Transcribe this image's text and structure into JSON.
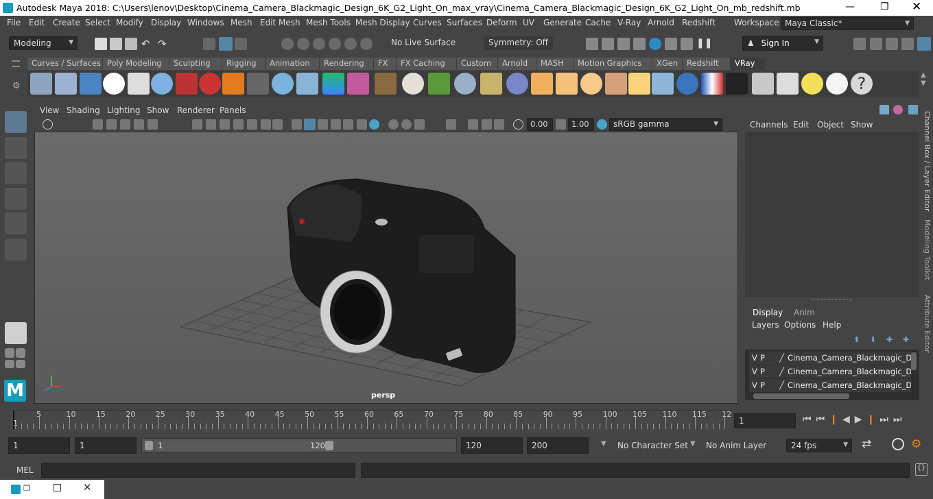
{
  "window": {
    "title": "Autodesk Maya 2018: C:\\Users\\lenov\\Desktop\\Cinema_Camera_Blackmagic_Design_6K_G2_Light_On_max_vray\\Cinema_Camera_Blackmagic_Design_6K_G2_Light_On_mb_redshift.mb"
  },
  "menubar": [
    "File",
    "Edit",
    "Create",
    "Select",
    "Modify",
    "Display",
    "Windows",
    "Mesh",
    "Edit Mesh",
    "Mesh Tools",
    "Mesh Display",
    "Curves",
    "Surfaces",
    "Deform",
    "UV",
    "Generate",
    "Cache",
    "V-Ray",
    "Arnold",
    "Redshift"
  ],
  "workspace": {
    "label": "Workspace :",
    "value": "Maya Classic*"
  },
  "status": {
    "mode": "Modeling",
    "live_surface": "No Live Surface",
    "symmetry": "Symmetry: Off",
    "sign_in": "Sign In"
  },
  "shelf_tabs": [
    "Curves / Surfaces",
    "Poly Modeling",
    "Sculpting",
    "Rigging",
    "Animation",
    "Rendering",
    "FX",
    "FX Caching",
    "Custom",
    "Arnold",
    "MASH",
    "Motion Graphics",
    "XGen",
    "Redshift",
    "VRay"
  ],
  "active_shelf": "VRay",
  "viewport": {
    "menu": [
      "View",
      "Shading",
      "Lighting",
      "Show",
      "Renderer",
      "Panels"
    ],
    "exposure": "0.00",
    "gamma": "1.00",
    "color_space": "sRGB gamma",
    "camera": "persp"
  },
  "channel_box": {
    "menu": [
      "Channels",
      "Edit",
      "Object",
      "Show"
    ]
  },
  "layer_editor": {
    "tabs": [
      "Display",
      "Anim"
    ],
    "menu": [
      "Layers",
      "Options",
      "Help"
    ],
    "layers": [
      {
        "v": "V",
        "p": "P",
        "name": "Cinema_Camera_Blackmagic_Desig"
      },
      {
        "v": "V",
        "p": "P",
        "name": "Cinema_Camera_Blackmagic_Desig"
      },
      {
        "v": "V",
        "p": "P",
        "name": "Cinema_Camera_Blackmagic_Desig"
      }
    ]
  },
  "side_tabs": [
    "Channel Box / Layer Editor",
    "Modeling Toolkit",
    "Attribute Editor"
  ],
  "timeline": {
    "ticks": [
      "5",
      "10",
      "15",
      "20",
      "25",
      "30",
      "35",
      "40",
      "45",
      "50",
      "55",
      "60",
      "65",
      "70",
      "75",
      "80",
      "85",
      "90",
      "95",
      "100",
      "105",
      "110",
      "115",
      "12"
    ],
    "start_label": "1",
    "current_frame": "1"
  },
  "range": {
    "start": "1",
    "playback_start": "1",
    "slider_start": "1",
    "slider_end": "120",
    "playback_end": "120",
    "end": "200",
    "character_set": "No Character Set",
    "anim_layer": "No Anim Layer",
    "fps": "24 fps"
  },
  "cmdline": {
    "label": "MEL"
  },
  "colors": {
    "bg": "#444444",
    "field": "#2b2b2b",
    "highlight": "#5285a6"
  }
}
